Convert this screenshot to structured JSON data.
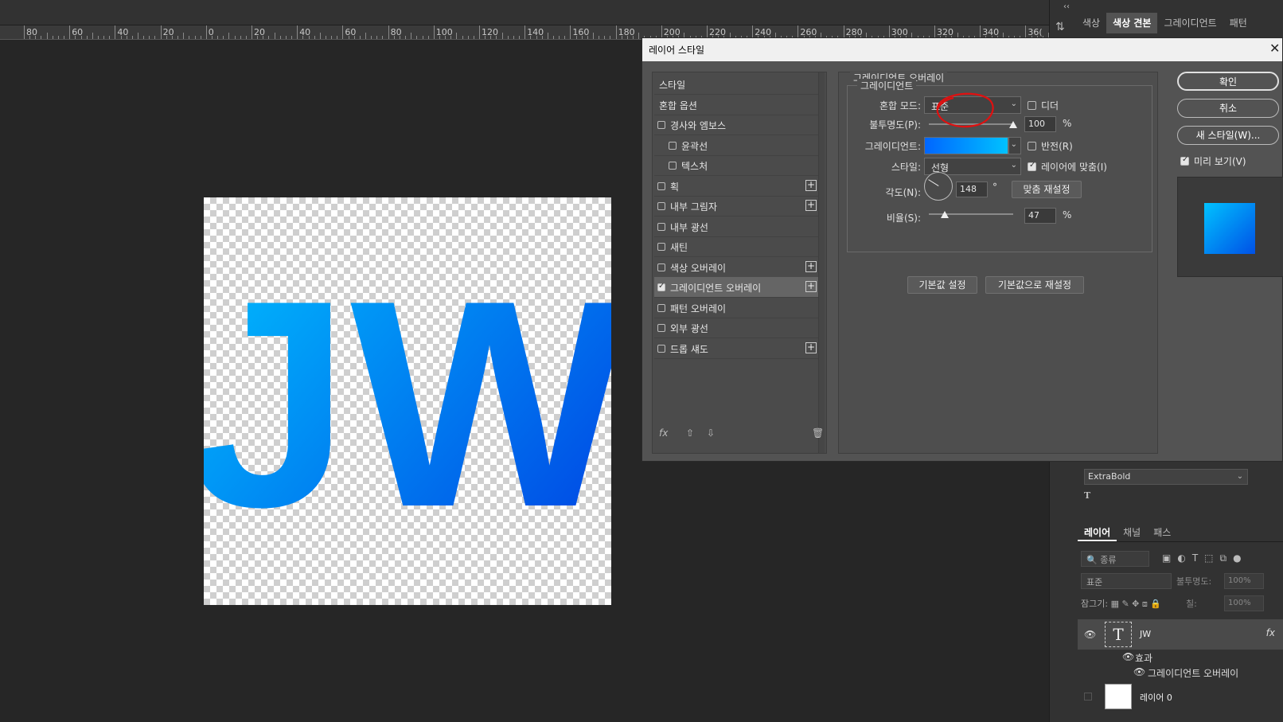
{
  "ruler": {
    "labels": [
      "80",
      "60",
      "40",
      "20",
      "0",
      "20",
      "40",
      "60",
      "80",
      "100",
      "120",
      "140",
      "160",
      "180",
      "200",
      "220",
      "240",
      "260",
      "280",
      "300",
      "320",
      "340",
      "36("
    ]
  },
  "canvas": {
    "text": "JW",
    "gradient_start": "#00c2ff",
    "gradient_end": "#0050e6"
  },
  "panel": {
    "tabs": [
      "색상",
      "색상 견본",
      "그레이디언트",
      "패턴"
    ],
    "active_tab": "색상 견본",
    "collapse_label": "‹‹",
    "font_style": "ExtraBold",
    "layers_tabs": [
      "레이어",
      "채널",
      "패스"
    ],
    "search_placeholder": "종류",
    "blend_mode": "표준",
    "opacity_label": "불투명도:",
    "opacity_value": "100%",
    "lock_label": "잠그기:",
    "fill_label": "칠:",
    "fill_value": "100%",
    "layers": [
      {
        "name": "JW",
        "thumb": "T",
        "fx": "fx"
      },
      {
        "name": "레이어 0",
        "thumb": ""
      }
    ],
    "effects_label": "효과",
    "effect_item": "그레이디언트 오버레이"
  },
  "dialog": {
    "title": "레이어 스타일",
    "close": "✕",
    "list": [
      {
        "label": "스타일",
        "checkbox": false,
        "indent": 0,
        "plus": false,
        "checked": false
      },
      {
        "label": "혼합 옵션",
        "checkbox": false,
        "indent": 0,
        "plus": false,
        "checked": false
      },
      {
        "label": "경사와 엠보스",
        "checkbox": true,
        "indent": 0,
        "plus": false,
        "checked": false
      },
      {
        "label": "윤곽선",
        "checkbox": true,
        "indent": 1,
        "plus": false,
        "checked": false
      },
      {
        "label": "텍스처",
        "checkbox": true,
        "indent": 1,
        "plus": false,
        "checked": false
      },
      {
        "label": "획",
        "checkbox": true,
        "indent": 0,
        "plus": true,
        "checked": false
      },
      {
        "label": "내부 그림자",
        "checkbox": true,
        "indent": 0,
        "plus": true,
        "checked": false
      },
      {
        "label": "내부 광선",
        "checkbox": true,
        "indent": 0,
        "plus": false,
        "checked": false
      },
      {
        "label": "새틴",
        "checkbox": true,
        "indent": 0,
        "plus": false,
        "checked": false
      },
      {
        "label": "색상 오버레이",
        "checkbox": true,
        "indent": 0,
        "plus": true,
        "checked": false
      },
      {
        "label": "그레이디언트 오버레이",
        "checkbox": true,
        "indent": 0,
        "plus": true,
        "checked": true,
        "selected": true
      },
      {
        "label": "패턴 오버레이",
        "checkbox": true,
        "indent": 0,
        "plus": false,
        "checked": false
      },
      {
        "label": "외부 광선",
        "checkbox": true,
        "indent": 0,
        "plus": false,
        "checked": false
      },
      {
        "label": "드롭 섀도",
        "checkbox": true,
        "indent": 0,
        "plus": true,
        "checked": false
      }
    ],
    "foot_fx": "fx",
    "section_title": "그레이디언트 오버레이",
    "group_title": "그레이디언트",
    "blend_label": "혼합 모드:",
    "blend_value": "표준",
    "dither_label": "디더",
    "opacity_label": "불투명도(P):",
    "opacity_value": "100",
    "opacity_fraction": 1.0,
    "percent": "%",
    "gradient_label": "그레이디언트:",
    "reverse_label": "반전(R)",
    "style_label": "스타일:",
    "style_value": "선형",
    "align_label": "레이어에 맞춤(I)",
    "angle_label": "각도(N):",
    "angle_value": "148",
    "degree": "°",
    "reset_align": "맞춤 재설정",
    "scale_label": "비율(S):",
    "scale_value": "47",
    "scale_fraction": 0.19,
    "make_default": "기본값 설정",
    "reset_default": "기본값으로 재설정",
    "ok": "확인",
    "cancel": "취소",
    "new_style": "새 스타일(W)...",
    "preview_label": "미리 보기(V)"
  }
}
